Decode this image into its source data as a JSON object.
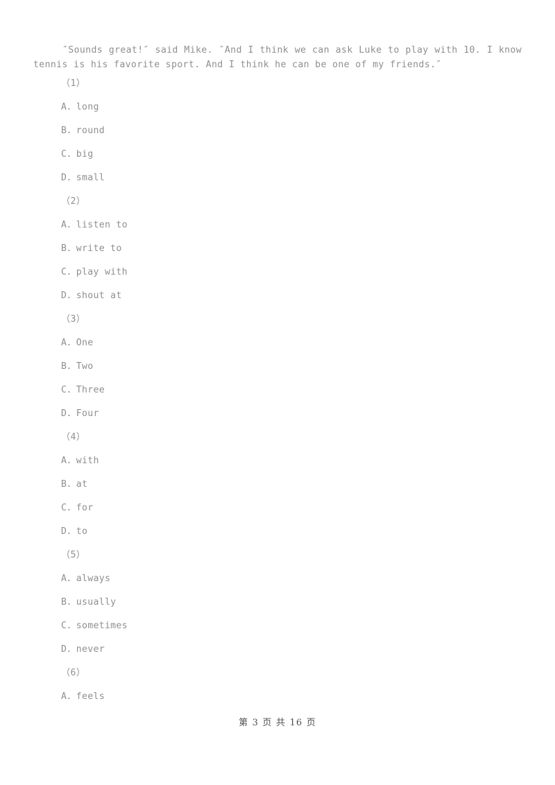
{
  "document": {
    "passage": "″Sounds great!″ said Mike. ″And I think we can ask Luke to play with 10. I know tennis is his favorite sport. And I think he can be one of my friends.″",
    "questions": [
      {
        "number": "（1）",
        "options": [
          {
            "letter": "A",
            "sep": "．",
            "text": "long"
          },
          {
            "letter": "B",
            "sep": "．",
            "text": "round"
          },
          {
            "letter": "C",
            "sep": "．",
            "text": "big"
          },
          {
            "letter": "D",
            "sep": "．",
            "text": "small"
          }
        ]
      },
      {
        "number": "（2）",
        "options": [
          {
            "letter": "A",
            "sep": "．",
            "text": "listen to"
          },
          {
            "letter": "B",
            "sep": "．",
            "text": "write to"
          },
          {
            "letter": "C",
            "sep": "．",
            "text": "play with"
          },
          {
            "letter": "D",
            "sep": "．",
            "text": "shout at"
          }
        ]
      },
      {
        "number": "（3）",
        "options": [
          {
            "letter": "A",
            "sep": "．",
            "text": "One"
          },
          {
            "letter": "B",
            "sep": "．",
            "text": "Two"
          },
          {
            "letter": "C",
            "sep": "．",
            "text": "Three"
          },
          {
            "letter": "D",
            "sep": "．",
            "text": "Four"
          }
        ]
      },
      {
        "number": "（4）",
        "options": [
          {
            "letter": "A",
            "sep": "．",
            "text": "with"
          },
          {
            "letter": "B",
            "sep": "．",
            "text": "at"
          },
          {
            "letter": "C",
            "sep": "．",
            "text": "for"
          },
          {
            "letter": "D",
            "sep": "．",
            "text": "to"
          }
        ]
      },
      {
        "number": "（5）",
        "options": [
          {
            "letter": "A",
            "sep": "．",
            "text": "always"
          },
          {
            "letter": "B",
            "sep": "．",
            "text": "usually"
          },
          {
            "letter": "C",
            "sep": "．",
            "text": "sometimes"
          },
          {
            "letter": "D",
            "sep": "．",
            "text": "never"
          }
        ]
      },
      {
        "number": "（6）",
        "options": [
          {
            "letter": "A",
            "sep": "．",
            "text": "feels"
          }
        ]
      }
    ],
    "footer": {
      "text": "第 3 页 共 16 页",
      "current_page": "3",
      "total_pages": "16"
    }
  }
}
